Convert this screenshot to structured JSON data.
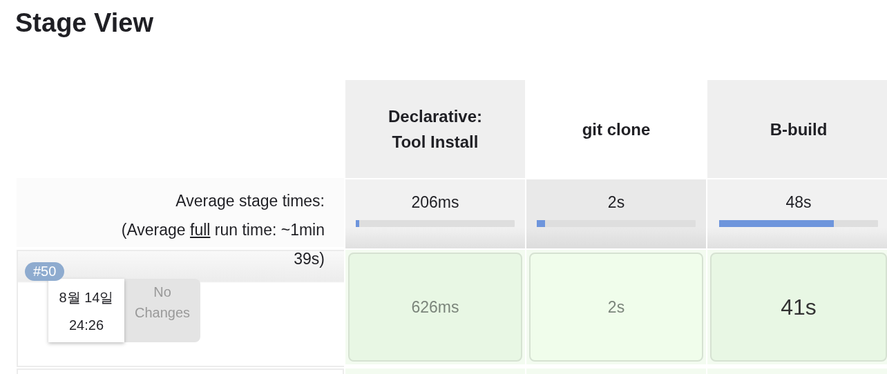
{
  "title": "Stage View",
  "stages": [
    {
      "name": "Declarative: Tool Install",
      "highlighted": false,
      "average": "206ms",
      "level": 0.02
    },
    {
      "name": "git clone",
      "highlighted": true,
      "average": "2s",
      "level": 0.05
    },
    {
      "name": "B-build",
      "highlighted": false,
      "average": "48s",
      "level": 0.72
    }
  ],
  "averages_label": "Average stage times:",
  "full_run": {
    "before": "(Average ",
    "link": "full",
    "after": " run time: ~1min 39s)"
  },
  "builds": [
    {
      "number": "#50",
      "date": "8월 14일",
      "time": "24:26",
      "changes": "No Changes",
      "cells": [
        {
          "duration": "626ms",
          "color": "#e8f7e4",
          "kind": "normal"
        },
        {
          "duration": "2s",
          "color": "#f0fdeb",
          "kind": "normal"
        },
        {
          "duration": "41s",
          "color": "#e8f7e4",
          "kind": "emphasized"
        }
      ]
    }
  ]
}
